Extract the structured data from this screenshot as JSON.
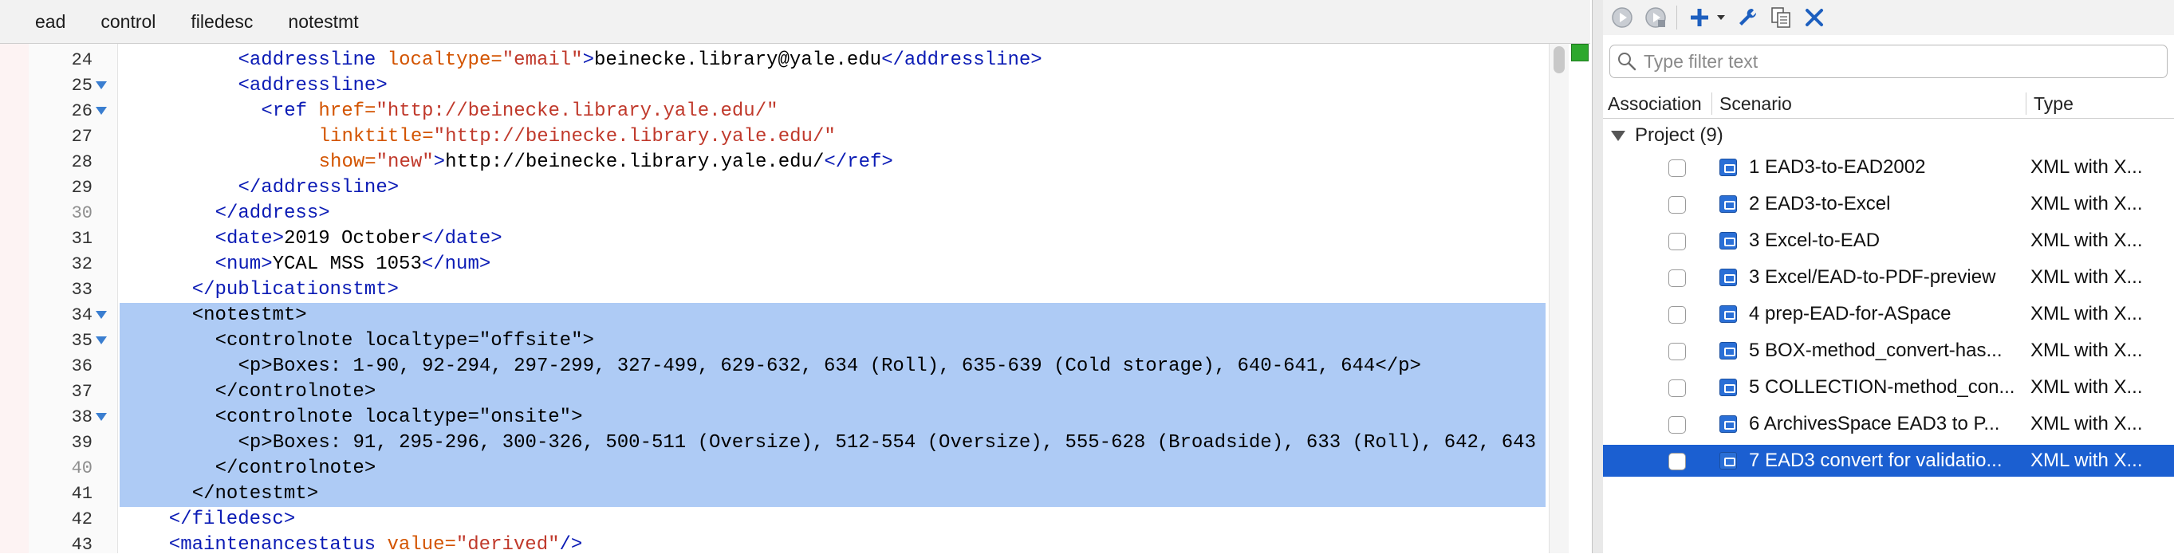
{
  "breadcrumb": [
    "ead",
    "control",
    "filedesc",
    "notestmt"
  ],
  "editor": {
    "lines": [
      {
        "num": "24",
        "fold": false,
        "selected": false,
        "dim": false,
        "indent": 10,
        "tokens": [
          [
            "tg",
            "<addressline "
          ],
          [
            "at",
            "localtype="
          ],
          [
            "av",
            "\"email\""
          ],
          [
            "tg",
            ">"
          ],
          [
            "tx",
            "beinecke.library@yale.edu"
          ],
          [
            "tg",
            "</addressline>"
          ]
        ]
      },
      {
        "num": "25",
        "fold": true,
        "selected": false,
        "dim": false,
        "indent": 10,
        "tokens": [
          [
            "tg",
            "<addressline>"
          ]
        ]
      },
      {
        "num": "26",
        "fold": true,
        "selected": false,
        "dim": false,
        "indent": 12,
        "tokens": [
          [
            "tg",
            "<ref "
          ],
          [
            "at",
            "href="
          ],
          [
            "av",
            "\"http://beinecke.library.yale.edu/\""
          ]
        ]
      },
      {
        "num": "27",
        "fold": false,
        "selected": false,
        "dim": false,
        "indent": 17,
        "tokens": [
          [
            "at",
            "linktitle="
          ],
          [
            "av",
            "\"http://beinecke.library.yale.edu/\""
          ]
        ]
      },
      {
        "num": "28",
        "fold": false,
        "selected": false,
        "dim": false,
        "indent": 17,
        "tokens": [
          [
            "at",
            "show="
          ],
          [
            "av",
            "\"new\""
          ],
          [
            "tg",
            ">"
          ],
          [
            "tx",
            "http://beinecke.library.yale.edu/"
          ],
          [
            "tg",
            "</ref>"
          ]
        ]
      },
      {
        "num": "29",
        "fold": false,
        "selected": false,
        "dim": false,
        "indent": 10,
        "tokens": [
          [
            "tg",
            "</addressline>"
          ]
        ]
      },
      {
        "num": "30",
        "fold": false,
        "selected": false,
        "dim": true,
        "indent": 8,
        "tokens": [
          [
            "tg",
            "</address>"
          ]
        ]
      },
      {
        "num": "31",
        "fold": false,
        "selected": false,
        "dim": false,
        "indent": 8,
        "tokens": [
          [
            "tg",
            "<date>"
          ],
          [
            "tx",
            "2019 October"
          ],
          [
            "tg",
            "</date>"
          ]
        ]
      },
      {
        "num": "32",
        "fold": false,
        "selected": false,
        "dim": false,
        "indent": 8,
        "tokens": [
          [
            "tg",
            "<num>"
          ],
          [
            "tx",
            "YCAL MSS 1053"
          ],
          [
            "tg",
            "</num>"
          ]
        ]
      },
      {
        "num": "33",
        "fold": false,
        "selected": false,
        "dim": false,
        "indent": 6,
        "tokens": [
          [
            "tg",
            "</publicationstmt>"
          ]
        ]
      },
      {
        "num": "34",
        "fold": true,
        "selected": true,
        "dim": false,
        "indent": 6,
        "tokens": [
          [
            "tx",
            "<notestmt>"
          ]
        ]
      },
      {
        "num": "35",
        "fold": true,
        "selected": true,
        "dim": false,
        "indent": 8,
        "tokens": [
          [
            "tx",
            "<controlnote localtype=\"offsite\">"
          ]
        ]
      },
      {
        "num": "36",
        "fold": false,
        "selected": true,
        "dim": false,
        "indent": 10,
        "tokens": [
          [
            "tx",
            "<p>Boxes: 1-90, 92-294, 297-299, 327-499, 629-632, 634 (Roll), 635-639 (Cold storage), 640-641, 644</p>"
          ]
        ]
      },
      {
        "num": "37",
        "fold": false,
        "selected": true,
        "dim": false,
        "indent": 8,
        "tokens": [
          [
            "tx",
            "</controlnote>"
          ]
        ]
      },
      {
        "num": "38",
        "fold": true,
        "selected": true,
        "dim": false,
        "indent": 8,
        "tokens": [
          [
            "tx",
            "<controlnote localtype=\"onsite\">"
          ]
        ]
      },
      {
        "num": "39",
        "fold": false,
        "selected": true,
        "dim": false,
        "indent": 10,
        "tokens": [
          [
            "tx",
            "<p>Boxes: 91, 295-296, 300-326, 500-511 (Oversize), 512-554 (Oversize), 555-628 (Broadside), 633 (Roll), 642, 643"
          ]
        ]
      },
      {
        "num": "40",
        "fold": false,
        "selected": true,
        "dim": true,
        "indent": 8,
        "tokens": [
          [
            "tx",
            "</controlnote>"
          ]
        ]
      },
      {
        "num": "41",
        "fold": false,
        "selected": true,
        "dim": false,
        "indent": 6,
        "tokens": [
          [
            "tx",
            "</notestmt>"
          ]
        ]
      },
      {
        "num": "42",
        "fold": false,
        "selected": false,
        "dim": false,
        "indent": 4,
        "tokens": [
          [
            "tg",
            "</filedesc>"
          ]
        ]
      },
      {
        "num": "43",
        "fold": false,
        "selected": false,
        "dim": false,
        "indent": 4,
        "tokens": [
          [
            "tg",
            "<maintenancestatus "
          ],
          [
            "at",
            "value="
          ],
          [
            "av",
            "\"derived\""
          ],
          [
            "tg",
            "/>"
          ]
        ]
      }
    ]
  },
  "panel": {
    "filter_placeholder": "Type filter text",
    "columns": {
      "association": "Association",
      "scenario": "Scenario",
      "type": "Type"
    },
    "group_label": "Project (9)",
    "scenarios": [
      {
        "name": "1 EAD3-to-EAD2002",
        "type": "XML with X...",
        "selected": false
      },
      {
        "name": "2 EAD3-to-Excel",
        "type": "XML with X...",
        "selected": false
      },
      {
        "name": "3 Excel-to-EAD",
        "type": "XML with X...",
        "selected": false
      },
      {
        "name": "3 Excel/EAD-to-PDF-preview",
        "type": "XML with X...",
        "selected": false
      },
      {
        "name": "4 prep-EAD-for-ASpace",
        "type": "XML with X...",
        "selected": false
      },
      {
        "name": "5 BOX-method_convert-has...",
        "type": "XML with X...",
        "selected": false
      },
      {
        "name": "5 COLLECTION-method_con...",
        "type": "XML with X...",
        "selected": false
      },
      {
        "name": "6 ArchivesSpace EAD3 to P...",
        "type": "XML with X...",
        "selected": false
      },
      {
        "name": "7 EAD3 convert for validatio...",
        "type": "XML with X...",
        "selected": true
      }
    ]
  },
  "colors": {
    "selection": "#aecbf5",
    "row_selected": "#1b5fd1",
    "tag": "#0b1bb5",
    "attr": "#d35400",
    "value": "#c0392b",
    "validation_ok": "#2da82d"
  }
}
